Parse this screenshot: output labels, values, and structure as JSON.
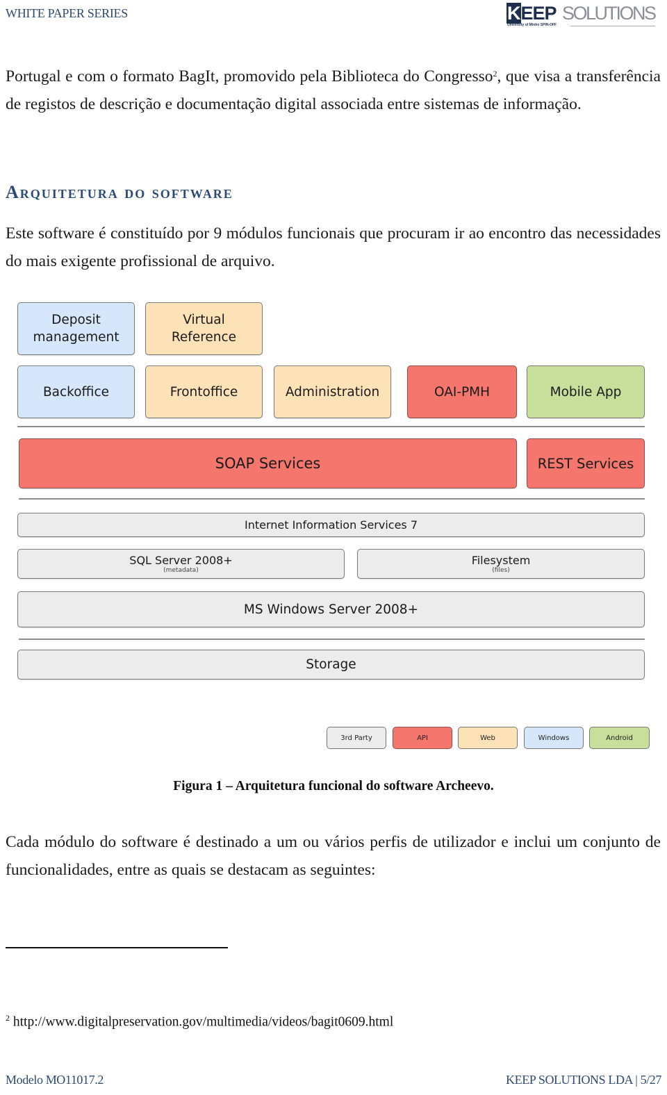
{
  "header": {
    "series": "WHITE PAPER SERIES",
    "logo": {
      "bold": "KEEP",
      "light": "SOLUTIONS",
      "tagline": "University of Minho SPIN-OFF"
    }
  },
  "intro": {
    "text": "Portugal e com o formato BagIt, promovido pela Biblioteca do Congresso",
    "footnote_ref": "2",
    "text_after": ", que visa a transferência de registos de descrição e documentação digital associada entre sistemas de informação."
  },
  "section": {
    "heading": "Arquitetura do software",
    "paragraph": "Este software é constituído por 9 módulos funcionais que procuram ir ao encontro das necessidades do mais exigente profissional de arquivo."
  },
  "diagram": {
    "modules_row1": [
      {
        "label_1": "Deposit",
        "label_2": "management",
        "color": "#d6e7fb"
      },
      {
        "label_1": "Virtual",
        "label_2": "Reference",
        "color": "#fde2b8"
      }
    ],
    "modules_row2": [
      {
        "label": "Backoffice",
        "color": "#d6e7fb"
      },
      {
        "label": "Frontoffice",
        "color": "#fde2b8"
      },
      {
        "label": "Administration",
        "color": "#fde2b8"
      },
      {
        "label": "OAI-PMH",
        "color": "#f4766c"
      },
      {
        "label": "Mobile App",
        "color": "#c8df9c"
      }
    ],
    "services": [
      {
        "label": "SOAP Services",
        "color": "#f4766c"
      },
      {
        "label": "REST Services",
        "color": "#f4766c"
      }
    ],
    "infrastructure": {
      "web_server": "Internet Information Services 7",
      "database": {
        "label": "SQL Server 2008+",
        "sub": "(metadata)"
      },
      "filesystem": {
        "label": "Filesystem",
        "sub": "(files)"
      },
      "os": "MS Windows Server 2008+",
      "storage": "Storage"
    },
    "legend": [
      {
        "label": "3rd Party",
        "color": "#ececec"
      },
      {
        "label": "API",
        "color": "#f4766c"
      },
      {
        "label": "Web",
        "color": "#fde2b8"
      },
      {
        "label": "Windows",
        "color": "#d6e7fb"
      },
      {
        "label": "Android",
        "color": "#c8df9c"
      }
    ]
  },
  "caption": "Figura 1 – Arquitetura funcional do software Archeevo.",
  "paragraph2": "Cada módulo do software é destinado a um ou vários perfis de utilizador e inclui um conjunto de funcionalidades, entre as quais se destacam as seguintes:",
  "footnote": {
    "number": "2",
    "text": "http://www.digitalpreservation.gov/multimedia/videos/bagit0609.html"
  },
  "footer": {
    "left": "Modelo MO11017.2",
    "company": "KEEP SOLUTIONS LDA",
    "separator": "|",
    "page": "5/27"
  }
}
